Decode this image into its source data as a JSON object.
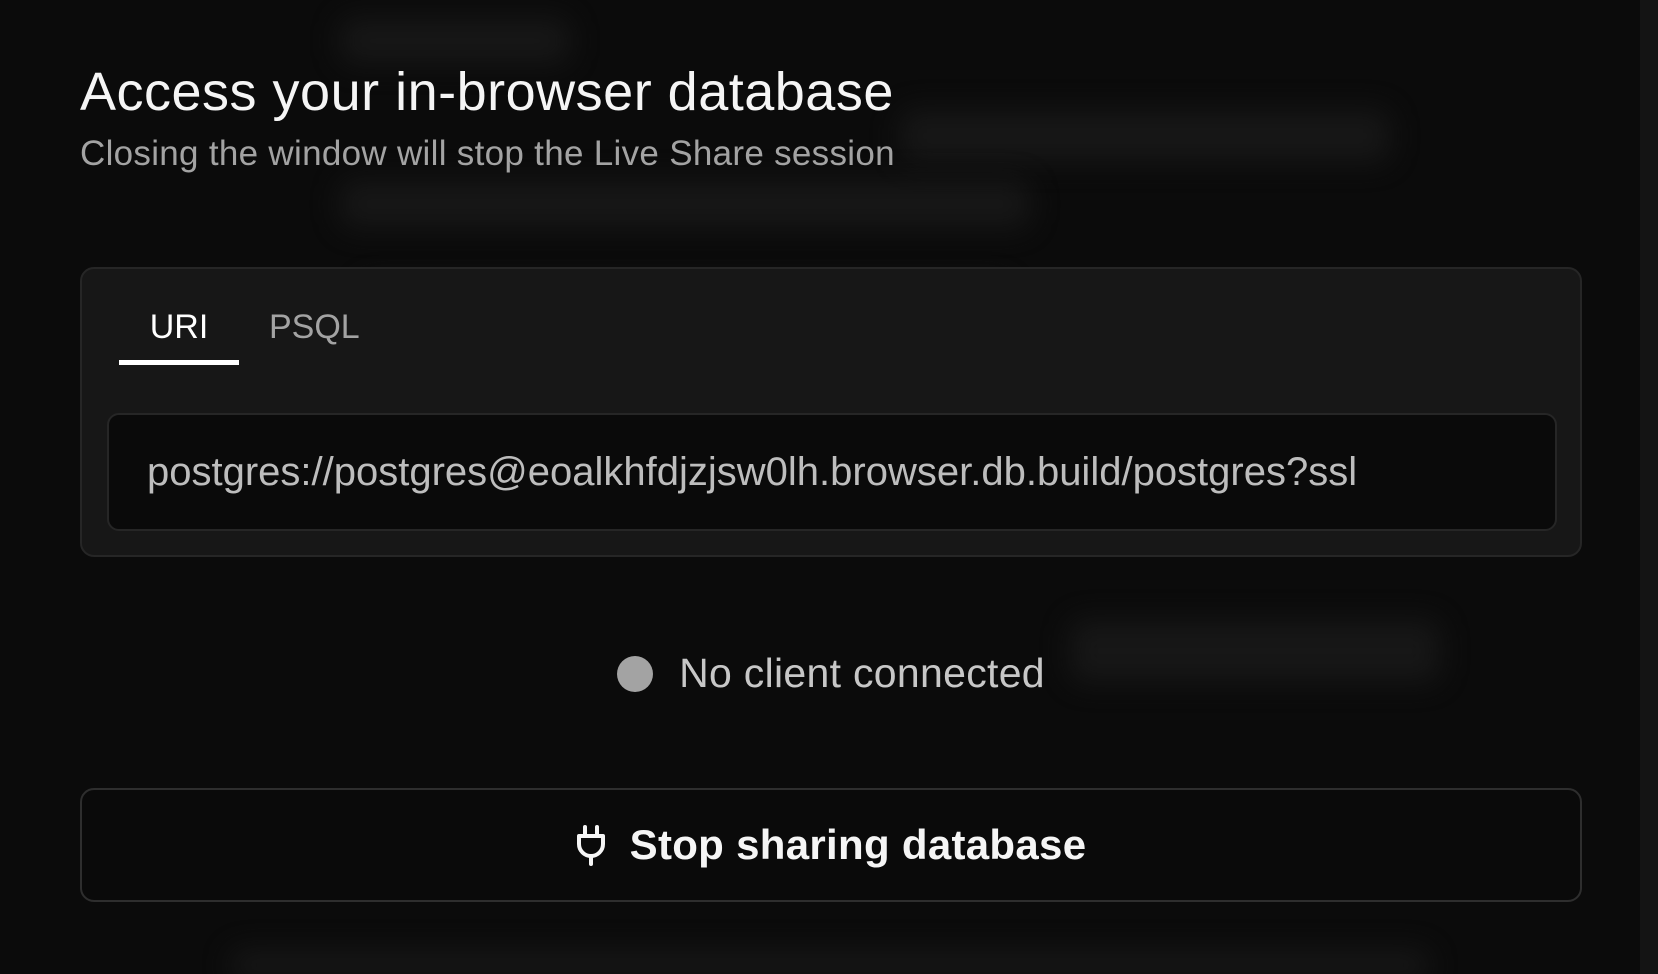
{
  "dialog": {
    "title": "Access your in-browser database",
    "subtitle": "Closing the window will stop the Live Share session"
  },
  "tabs": [
    {
      "label": "URI",
      "active": true
    },
    {
      "label": "PSQL",
      "active": false
    }
  ],
  "connection": {
    "uri": "postgres://postgres@eoalkhfdjzjsw0lh.browser.db.build/postgres?ssl"
  },
  "status": {
    "text": "No client connected",
    "dot_color": "#a3a3a3"
  },
  "actions": {
    "stop_label": "Stop sharing database",
    "stop_icon": "plug-icon"
  }
}
